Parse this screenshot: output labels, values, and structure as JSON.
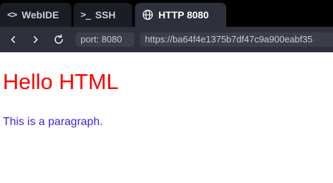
{
  "tabs": [
    {
      "label": "WebIDE",
      "icon": "code-brackets-icon",
      "icon_text": "<>",
      "active": false
    },
    {
      "label": "SSH",
      "icon": "terminal-icon",
      "icon_text": ">_",
      "active": false
    },
    {
      "label": "HTTP 8080",
      "icon": "globe-icon",
      "active": true
    }
  ],
  "navbar": {
    "port_label": "port: 8080",
    "url": "https://ba64f4e1375b7df47c9a900eabf35"
  },
  "page": {
    "heading": "Hello HTML",
    "paragraph": "This is a paragraph."
  },
  "colors": {
    "heading": "#ff0000",
    "paragraph": "#3a28d6",
    "chrome_background": "#000000",
    "active_tab": "#2e313b",
    "inactive_tab": "#1b1d24"
  }
}
